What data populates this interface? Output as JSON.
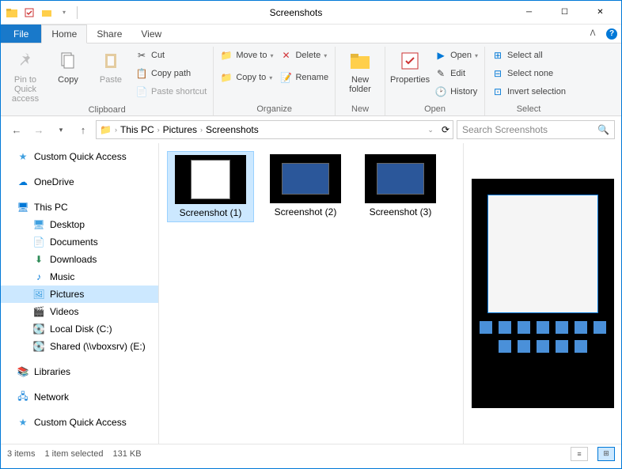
{
  "title": "Screenshots",
  "tabs": {
    "file": "File",
    "home": "Home",
    "share": "Share",
    "view": "View"
  },
  "ribbon": {
    "pin": "Pin to Quick\naccess",
    "copy": "Copy",
    "paste": "Paste",
    "cut": "Cut",
    "copypath": "Copy path",
    "pasteshortcut": "Paste shortcut",
    "clipboard": "Clipboard",
    "moveto": "Move to",
    "copyto": "Copy to",
    "delete": "Delete",
    "rename": "Rename",
    "organize": "Organize",
    "newfolder": "New\nfolder",
    "new": "New",
    "properties": "Properties",
    "open": "Open",
    "edit": "Edit",
    "history": "History",
    "open_group": "Open",
    "selectall": "Select all",
    "selectnone": "Select none",
    "invert": "Invert selection",
    "select": "Select"
  },
  "breadcrumb": [
    "This PC",
    "Pictures",
    "Screenshots"
  ],
  "search_placeholder": "Search Screenshots",
  "nav": {
    "quickaccess": "Custom Quick Access",
    "onedrive": "OneDrive",
    "thispc": "This PC",
    "desktop": "Desktop",
    "documents": "Documents",
    "downloads": "Downloads",
    "music": "Music",
    "pictures": "Pictures",
    "videos": "Videos",
    "localdisk": "Local Disk (C:)",
    "shared": "Shared (\\\\vboxsrv) (E:)",
    "libraries": "Libraries",
    "network": "Network",
    "quickaccess2": "Custom Quick Access"
  },
  "files": [
    {
      "name": "Screenshot (1)",
      "selected": true
    },
    {
      "name": "Screenshot (2)",
      "selected": false
    },
    {
      "name": "Screenshot (3)",
      "selected": false
    }
  ],
  "status": {
    "count": "3 items",
    "selected": "1 item selected",
    "size": "131 KB"
  }
}
